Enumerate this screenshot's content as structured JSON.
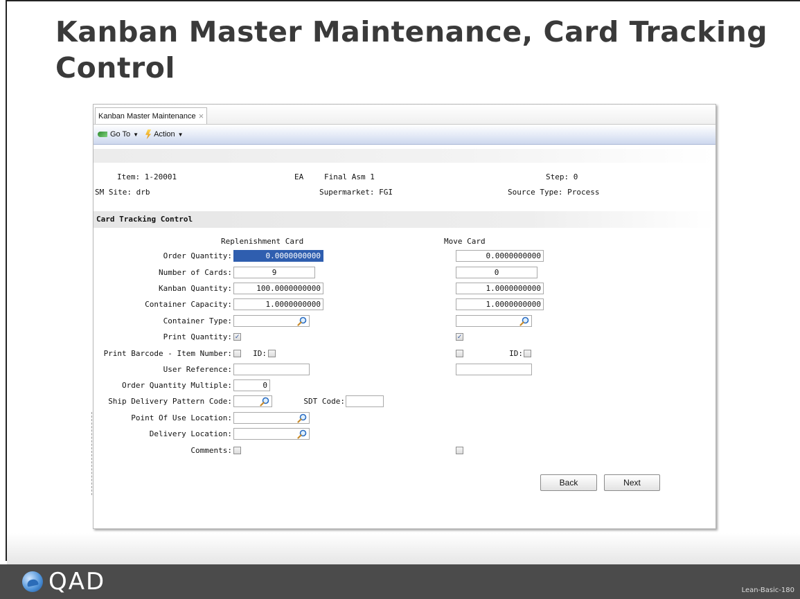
{
  "slide": {
    "title": "Kanban Master Maintenance, Card Tracking Control",
    "logo_text": "QAD",
    "slide_id": "Lean-Basic-180"
  },
  "window": {
    "tab_label": "Kanban Master Maintenance",
    "tab_close": "×",
    "toolbar": {
      "goto": "Go To",
      "action": "Action",
      "dropdown_arrow": "▼"
    }
  },
  "header": {
    "item_label": "Item:",
    "item_value": "1-20001",
    "um": "EA",
    "description": "Final Asm 1",
    "step_label": "Step:",
    "step_value": "0",
    "site_label": "SM Site:",
    "site_value": "drb",
    "supermarket_label": "Supermarket:",
    "supermarket_value": "FGI",
    "source_type_label": "Source Type:",
    "source_type_value": "Process"
  },
  "section": {
    "title": "Card Tracking Control",
    "col_replenishment": "Replenishment Card",
    "col_move": "Move Card"
  },
  "labels": {
    "order_quantity": "Order Quantity:",
    "number_of_cards": "Number of Cards:",
    "kanban_quantity": "Kanban Quantity:",
    "container_capacity": "Container Capacity:",
    "container_type": "Container Type:",
    "print_quantity": "Print Quantity:",
    "print_barcode": "Print Barcode - Item Number:",
    "id": "ID:",
    "user_reference": "User Reference:",
    "order_quantity_multiple": "Order Quantity Multiple:",
    "ship_delivery_pattern": "Ship Delivery Pattern Code:",
    "sdt_code": "SDT Code:",
    "point_of_use": "Point Of Use Location:",
    "delivery_location": "Delivery Location:",
    "comments": "Comments:"
  },
  "replenishment": {
    "order_quantity": "0.0000000000",
    "number_of_cards": "9",
    "kanban_quantity": "100.0000000000",
    "container_capacity": "1.0000000000",
    "container_type": "",
    "print_quantity": true,
    "print_barcode": false,
    "barcode_id": false,
    "user_reference": "",
    "order_quantity_multiple": "0",
    "ship_delivery_pattern": "",
    "sdt_code": "",
    "point_of_use": "",
    "delivery_location": "",
    "comments": false
  },
  "move": {
    "order_quantity": "0.0000000000",
    "number_of_cards": "0",
    "kanban_quantity": "1.0000000000",
    "container_capacity": "1.0000000000",
    "container_type": "",
    "print_quantity": true,
    "print_barcode": false,
    "barcode_id": false,
    "user_reference": "",
    "comments": false
  },
  "buttons": {
    "back": "Back",
    "next": "Next"
  },
  "icons": {
    "lookup": "magnifier-icon",
    "goto": "goto-arrow-icon",
    "action": "lightning-icon"
  },
  "colors": {
    "selection": "#2f5eaf",
    "title": "#3a3a3a",
    "footer": "#4b4b4b"
  }
}
